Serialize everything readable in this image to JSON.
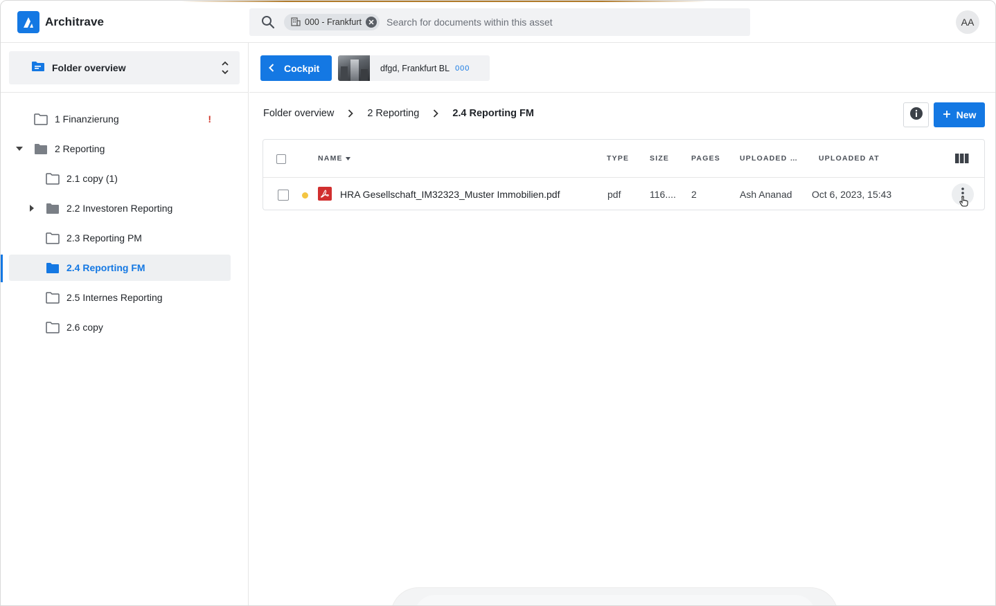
{
  "app": {
    "name": "Architrave"
  },
  "header": {
    "search": {
      "chip_label": "000 - Frankfurt",
      "placeholder": "Search for documents within this asset"
    },
    "avatar_initials": "AA"
  },
  "sidebar": {
    "selector_label": "Folder overview",
    "tree": [
      {
        "label": "1 Finanzierung",
        "warning": "!"
      },
      {
        "label": "2 Reporting",
        "expanded": true
      },
      {
        "label": "2.1 copy (1)"
      },
      {
        "label": "2.2 Investoren Reporting",
        "collapsed": true
      },
      {
        "label": "2.3 Reporting PM"
      },
      {
        "label": "2.4 Reporting FM",
        "active": true
      },
      {
        "label": "2.5 Internes Reporting"
      },
      {
        "label": "2.6 copy"
      }
    ]
  },
  "main": {
    "cockpit_label": "Cockpit",
    "asset": {
      "name": "dfgd,  Frankfurt BL",
      "code": "000"
    },
    "breadcrumb": [
      "Folder overview",
      "2 Reporting",
      "2.4 Reporting FM"
    ],
    "new_label": "New",
    "table": {
      "headers": {
        "name": "NAME",
        "type": "TYPE",
        "size": "SIZE",
        "pages": "PAGES",
        "uploaded_by": "UPLOADED …",
        "uploaded_at": "UPLOADED AT"
      },
      "rows": [
        {
          "name": "HRA Gesellschaft_IM32323_Muster Immobilien.pdf",
          "type": "pdf",
          "size": "116....",
          "pages": "2",
          "uploaded_by": "Ash Ananad",
          "uploaded_at": "Oct 6, 2023, 15:43"
        }
      ]
    }
  },
  "colors": {
    "accent": "#1478e3",
    "warning": "#d0362a",
    "status_dot": "#f4c542",
    "pdf": "#d12f2f"
  }
}
